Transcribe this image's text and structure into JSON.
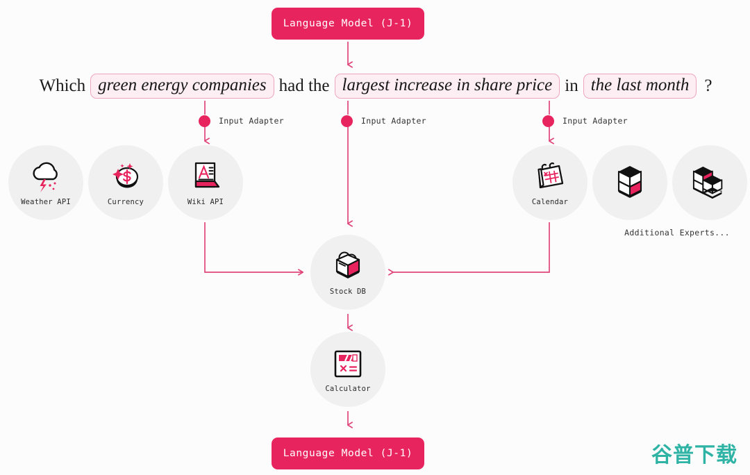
{
  "diagram": {
    "top_model": {
      "label": "Language Model (J-1)"
    },
    "bottom_model": {
      "label": "Language Model (J-1)"
    },
    "question": {
      "prefix": "Which",
      "slot1": "green energy companies",
      "mid1": "had the",
      "slot2": "largest increase in share price",
      "mid2": "in",
      "slot3": "the last month",
      "suffix": "?"
    },
    "adapters": [
      {
        "label": "Input Adapter"
      },
      {
        "label": "Input Adapter"
      },
      {
        "label": "Input Adapter"
      }
    ],
    "experts_left": [
      {
        "label": "Weather API",
        "icon": "cloud-lightning-icon"
      },
      {
        "label": "Currency",
        "icon": "coin-dollar-icon"
      },
      {
        "label": "Wiki API",
        "icon": "document-a-icon"
      }
    ],
    "experts_right": [
      {
        "label": "Calendar",
        "icon": "calendar-icon"
      },
      {
        "label": "",
        "icon": "stacked-cubes-icon"
      },
      {
        "label": "",
        "icon": "cube-cluster-icon"
      }
    ],
    "additional_experts_label": "Additional Experts...",
    "stock_db": {
      "label": "Stock DB",
      "icon": "open-box-icon"
    },
    "calculator": {
      "label": "Calculator",
      "icon": "calculator-icon"
    },
    "watermark": "谷普下载",
    "colors": {
      "accent_pink": "#e8245e",
      "wire_pink": "#e0457a",
      "slot_fill": "#fdeef3",
      "slot_border": "#f0a5bf",
      "node_circle": "#f0f0f0",
      "background": "#fcfcfc",
      "watermark_teal": "#2eb3a5"
    }
  }
}
